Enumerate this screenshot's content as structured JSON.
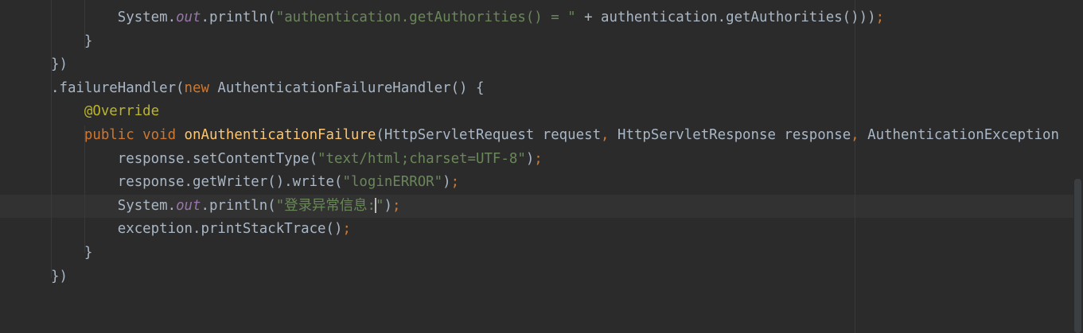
{
  "editor": {
    "lines": [
      {
        "name": "line-sysout-authorities",
        "tokens": [
          {
            "text": "        ",
            "cls": "plain"
          },
          {
            "text": "System.",
            "cls": "plain"
          },
          {
            "text": "out",
            "cls": "fld"
          },
          {
            "text": ".println(",
            "cls": "plain"
          },
          {
            "text": "\"authentication.getAuthorities() = \"",
            "cls": "str"
          },
          {
            "text": " + authentication.getAuthorities())",
            "cls": "plain"
          },
          {
            "text": ")",
            "cls": "plain"
          },
          {
            "text": ";",
            "cls": "kw"
          }
        ]
      },
      {
        "name": "line-close-method-1",
        "tokens": [
          {
            "text": "    }",
            "cls": "plain"
          }
        ]
      },
      {
        "name": "line-close-handler-1",
        "tokens": [
          {
            "text": "})",
            "cls": "plain"
          }
        ]
      },
      {
        "name": "line-failure-handler",
        "tokens": [
          {
            "text": ".failureHandler(",
            "cls": "plain"
          },
          {
            "text": "new ",
            "cls": "kw"
          },
          {
            "text": "AuthenticationFailureHandler() {",
            "cls": "plain"
          }
        ]
      },
      {
        "name": "line-override",
        "tokens": [
          {
            "text": "    ",
            "cls": "plain"
          },
          {
            "text": "@Override",
            "cls": "ann"
          }
        ]
      },
      {
        "name": "line-method-signature",
        "tokens": [
          {
            "text": "    ",
            "cls": "plain"
          },
          {
            "text": "public void ",
            "cls": "kw"
          },
          {
            "text": "onAuthenticationFailure",
            "cls": "mth"
          },
          {
            "text": "(HttpServletRequest request",
            "cls": "plain"
          },
          {
            "text": ", ",
            "cls": "kw"
          },
          {
            "text": "HttpServletResponse response",
            "cls": "plain"
          },
          {
            "text": ", ",
            "cls": "kw"
          },
          {
            "text": "AuthenticationException",
            "cls": "plain"
          }
        ]
      },
      {
        "name": "line-set-content-type",
        "tokens": [
          {
            "text": "        ",
            "cls": "plain"
          },
          {
            "text": "response.setContentType(",
            "cls": "plain"
          },
          {
            "text": "\"text/html;charset=UTF-8\"",
            "cls": "str"
          },
          {
            "text": ")",
            "cls": "plain"
          },
          {
            "text": ";",
            "cls": "kw"
          }
        ]
      },
      {
        "name": "line-write-error",
        "tokens": [
          {
            "text": "        ",
            "cls": "plain"
          },
          {
            "text": "response.getWriter().write(",
            "cls": "plain"
          },
          {
            "text": "\"loginERROR\"",
            "cls": "str"
          },
          {
            "text": ")",
            "cls": "plain"
          },
          {
            "text": ";",
            "cls": "kw"
          }
        ]
      },
      {
        "name": "line-sysout-login-error",
        "current": true,
        "tokens": [
          {
            "text": "        ",
            "cls": "plain"
          },
          {
            "text": "System.",
            "cls": "plain"
          },
          {
            "text": "out",
            "cls": "fld"
          },
          {
            "text": ".println(",
            "cls": "plain"
          },
          {
            "text": "\"登录异常信息:",
            "cls": "str"
          },
          {
            "text": "",
            "cls": "caret"
          },
          {
            "text": "\"",
            "cls": "str"
          },
          {
            "text": ")",
            "cls": "plain"
          },
          {
            "text": ";",
            "cls": "kw"
          }
        ]
      },
      {
        "name": "line-print-stack-trace",
        "tokens": [
          {
            "text": "        ",
            "cls": "plain"
          },
          {
            "text": "exception.printStackTrace()",
            "cls": "plain"
          },
          {
            "text": ";",
            "cls": "kw"
          }
        ]
      },
      {
        "name": "line-close-method-2",
        "tokens": [
          {
            "text": "    }",
            "cls": "plain"
          }
        ]
      },
      {
        "name": "line-close-handler-2",
        "tokens": [
          {
            "text": "})",
            "cls": "plain"
          }
        ]
      }
    ]
  }
}
